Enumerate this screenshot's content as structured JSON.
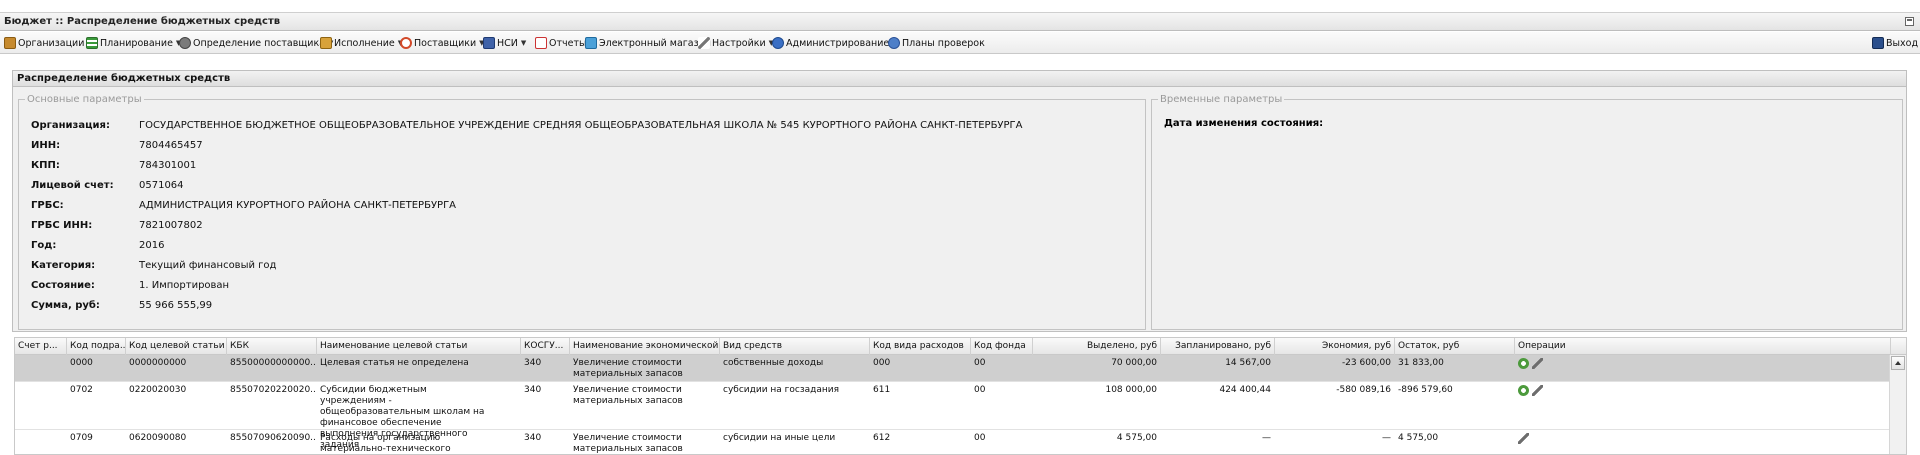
{
  "window": {
    "title": "Бюджет :: Распределение бюджетных средств"
  },
  "menu": {
    "items": [
      {
        "label": "Организации",
        "icon": "building-icon",
        "caret": true
      },
      {
        "label": "Планирование",
        "icon": "list-icon",
        "caret": true
      },
      {
        "label": "Определение поставщика",
        "icon": "search-person-icon",
        "caret": true
      },
      {
        "label": "Исполнение",
        "icon": "execution-icon",
        "caret": true
      },
      {
        "label": "Поставщики",
        "icon": "supplier-icon",
        "caret": true
      },
      {
        "label": "НСИ",
        "icon": "book-icon",
        "caret": true
      },
      {
        "label": "Отчеты",
        "icon": "report-icon",
        "caret": false
      },
      {
        "label": "Электронный магазин",
        "icon": "shop-icon",
        "caret": false
      },
      {
        "label": "Настройки",
        "icon": "wrench-icon",
        "caret": true
      },
      {
        "label": "Администрирование",
        "icon": "admin-icon",
        "caret": true
      },
      {
        "label": "Планы проверок",
        "icon": "user-icon",
        "caret": false
      }
    ],
    "exit_label": "Выход"
  },
  "panel": {
    "title": "Распределение бюджетных средств"
  },
  "main_params": {
    "legend": "Основные параметры",
    "fields": [
      {
        "label": "Организация:",
        "value": "ГОСУДАРСТВЕННОЕ БЮДЖЕТНОЕ ОБЩЕОБРАЗОВАТЕЛЬНОЕ УЧРЕЖДЕНИЕ СРЕДНЯЯ ОБЩЕОБРАЗОВАТЕЛЬНАЯ ШКОЛА № 545 КУРОРТНОГО РАЙОНА САНКТ-ПЕТЕРБУРГА"
      },
      {
        "label": "ИНН:",
        "value": "7804465457"
      },
      {
        "label": "КПП:",
        "value": "784301001"
      },
      {
        "label": "Лицевой счет:",
        "value": "0571064"
      },
      {
        "label": "ГРБС:",
        "value": "АДМИНИСТРАЦИЯ КУРОРТНОГО РАЙОНА САНКТ-ПЕТЕРБУРГА"
      },
      {
        "label": "ГРБС ИНН:",
        "value": "7821007802"
      },
      {
        "label": "Год:",
        "value": "2016"
      },
      {
        "label": "Категория:",
        "value": "Текущий финансовый год"
      },
      {
        "label": "Состояние:",
        "value": "1. Импортирован"
      },
      {
        "label": "Сумма, руб:",
        "value": "55 966 555,99"
      }
    ]
  },
  "time_params": {
    "legend": "Временные параметры",
    "label": "Дата изменения состояния:",
    "value": "-"
  },
  "table": {
    "columns": [
      "Счет р...",
      "Код подра...",
      "Код целевой статьи",
      "КБК",
      "Наименование целевой статьи",
      "КОСГУ...",
      "Наименование экономической ...",
      "Вид средств",
      "Код вида расходов",
      "Код фонда",
      "Выделено, руб",
      "Запланировано, руб",
      "Экономия, руб",
      "Остаток, руб",
      "Операции"
    ],
    "rows": [
      {
        "cells": [
          "",
          "0000",
          "0000000000",
          "85500000000000...",
          "Целевая статья не определена",
          "340",
          "Увеличение стоимости материальных запасов",
          "собственные доходы",
          "000",
          "00",
          "70 000,00",
          "14 567,00",
          "-23 600,00",
          "31 833,00"
        ],
        "ops": [
          "refresh-icon",
          "wrench-icon"
        ],
        "selected": true
      },
      {
        "cells": [
          "",
          "0702",
          "0220020030",
          "85507020220020...",
          "Субсидии бюджетным учреждениям - общеобразовательным школам на финансовое обеспечение выполнения государственного задания",
          "340",
          "Увеличение стоимости материальных запасов",
          "субсидии на госзадания",
          "611",
          "00",
          "108 000,00",
          "424 400,44",
          "-580 089,16",
          "-896 579,60"
        ],
        "ops": [
          "refresh-icon",
          "wrench-icon"
        ],
        "selected": false
      },
      {
        "cells": [
          "",
          "0709",
          "0620090080",
          "85507090620090...",
          "Расходы на организацию материально-технического обеспечения государственных",
          "340",
          "Увеличение стоимости материальных запасов",
          "субсидии на иные цели",
          "612",
          "00",
          "4 575,00",
          "—",
          "—",
          "4 575,00"
        ],
        "ops": [
          "wrench-icon"
        ],
        "selected": false
      }
    ]
  }
}
